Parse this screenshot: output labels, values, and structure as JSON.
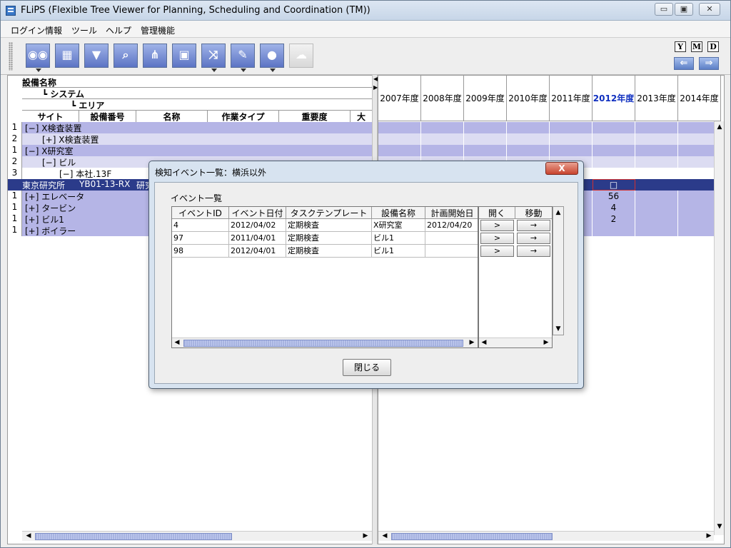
{
  "window": {
    "title": "FLiPS (Flexible Tree Viewer for Planning, Scheduling and Coordination (TM))",
    "minimize": "▭",
    "maximize": "▣",
    "close": "✕"
  },
  "menu": [
    "ログイン情報",
    "ツール",
    "ヘルプ",
    "管理機能"
  ],
  "toolbar": {
    "buttons": [
      {
        "icon": "binoculars-icon",
        "glyph": "◉◉",
        "dropdown": true
      },
      {
        "icon": "blocks-icon",
        "glyph": "▦",
        "dropdown": false
      },
      {
        "icon": "filter-icon",
        "glyph": "▼",
        "dropdown": false
      },
      {
        "icon": "search-icon",
        "glyph": "⌕",
        "dropdown": false
      },
      {
        "icon": "hierarchy-icon",
        "glyph": "⋔",
        "dropdown": false
      },
      {
        "icon": "cubes-icon",
        "glyph": "▣",
        "dropdown": false
      },
      {
        "icon": "chart-icon",
        "glyph": "⤨",
        "dropdown": true
      },
      {
        "icon": "report-icon",
        "glyph": "✎",
        "dropdown": true
      },
      {
        "icon": "alarm-icon",
        "glyph": "●",
        "dropdown": true
      },
      {
        "icon": "comment-icon",
        "glyph": "☁",
        "dropdown": false
      }
    ],
    "period_y": "Y",
    "period_m": "M",
    "period_d": "D",
    "prev": "⇐",
    "next": "⇒"
  },
  "tree": {
    "header_name": "設備名称",
    "header_system": "┗ システム",
    "header_area": "┗ エリア",
    "columns": [
      "サイト",
      "設備番号",
      "名称",
      "作業タイプ",
      "重要度",
      "大"
    ],
    "rows": [
      {
        "num": "1",
        "text": "[−]  X検査装置",
        "indent": 0,
        "style": "dark"
      },
      {
        "num": "2",
        "text": "[+]  X検査装置",
        "indent": 1,
        "style": "light"
      },
      {
        "num": "1",
        "text": "[−]  X研究室",
        "indent": 0,
        "style": "dark"
      },
      {
        "num": "2",
        "text": "[−]  ビル",
        "indent": 1,
        "style": "light"
      },
      {
        "num": "3",
        "text": "[−]  本社.13F",
        "indent": 2,
        "style": "white"
      },
      {
        "num": "",
        "text": "",
        "indent": 0,
        "style": "selected",
        "cells": [
          "東京研究所",
          "YB01-13-RX",
          "研究"
        ]
      },
      {
        "num": "1",
        "text": "[+]  エレベータ",
        "indent": 0,
        "style": "dark"
      },
      {
        "num": "1",
        "text": "[+]  タービン",
        "indent": 0,
        "style": "dark"
      },
      {
        "num": "1",
        "text": "[+]  ビル1",
        "indent": 0,
        "style": "dark"
      },
      {
        "num": "1",
        "text": "[+]  ボイラー",
        "indent": 0,
        "style": "dark"
      }
    ]
  },
  "grid": {
    "years": [
      "2007年度",
      "2008年度",
      "2009年度",
      "2010年度",
      "2011年度",
      "2012年度",
      "2013年度",
      "2014年度"
    ],
    "current_year_index": 5,
    "current_cells": [
      "",
      "",
      "",
      "",
      "",
      "□",
      "56",
      "4",
      "2",
      ""
    ]
  },
  "dialog": {
    "title": "検知イベント一覧：横浜以外",
    "close_x": "X",
    "subtitle": "イベント一覧",
    "columns": [
      "イベントID",
      "イベント日付",
      "タスクテンプレート",
      "設備名称",
      "計画開始日"
    ],
    "action_columns": [
      "開く",
      "移動"
    ],
    "rows": [
      {
        "id": "4",
        "date": "2012/04/02",
        "template": "定期検査",
        "equipment": "X研究室",
        "plan_start": "2012/04/20",
        "open": ">",
        "move": "→"
      },
      {
        "id": "97",
        "date": "2011/04/01",
        "template": "定期検査",
        "equipment": "ビル1",
        "plan_start": "",
        "open": ">",
        "move": "→"
      },
      {
        "id": "98",
        "date": "2012/04/01",
        "template": "定期検査",
        "equipment": "ビル1",
        "plan_start": "",
        "open": ">",
        "move": "→"
      }
    ],
    "close_button": "閉じる"
  }
}
